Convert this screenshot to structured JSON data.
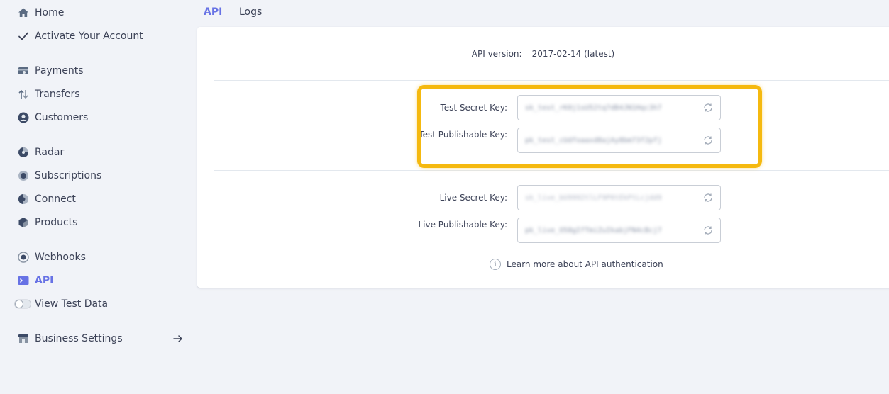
{
  "sidebar": {
    "items": [
      {
        "label": "Home",
        "icon": "home-icon"
      },
      {
        "label": "Activate Your Account",
        "icon": "checkmark-icon"
      },
      {
        "label": "Payments",
        "icon": "payments-icon"
      },
      {
        "label": "Transfers",
        "icon": "transfers-icon"
      },
      {
        "label": "Customers",
        "icon": "customers-icon"
      },
      {
        "label": "Radar",
        "icon": "radar-icon"
      },
      {
        "label": "Subscriptions",
        "icon": "subscriptions-icon"
      },
      {
        "label": "Connect",
        "icon": "connect-icon"
      },
      {
        "label": "Products",
        "icon": "products-icon"
      },
      {
        "label": "Webhooks",
        "icon": "webhooks-icon"
      },
      {
        "label": "API",
        "icon": "terminal-icon",
        "active": true
      },
      {
        "label": "View Test Data",
        "icon": "toggle-icon"
      },
      {
        "label": "Business Settings",
        "icon": "store-icon"
      }
    ]
  },
  "tabs": [
    {
      "label": "API",
      "active": true
    },
    {
      "label": "Logs",
      "active": false
    }
  ],
  "api_version": {
    "label": "API version:",
    "value": "2017-02-14 (latest)"
  },
  "keys": {
    "test_secret": {
      "label": "Test Secret Key:",
      "value": "sk_test_rK0j1sU52tq7dB4JN1Hqc3h7"
    },
    "test_publishable": {
      "label": "Test Publishable Key:",
      "value": "pk_test_cUdfoaaxd8ajAy8bm73f2pfj"
    },
    "live_secret": {
      "label": "Live Secret Key:",
      "value": "sk_live_bU9992tlLF9P0tEkPtLcjdd9"
    },
    "live_publishable": {
      "label": "Live Publishable Key:",
      "value": "pk_live_O58gIfTmiZuIkabjFN4cBcj7"
    }
  },
  "learn_more": "Learn more about API authentication",
  "colors": {
    "accent": "#6772e5",
    "highlight": "#f5b90f",
    "background": "#f1f3f8"
  }
}
